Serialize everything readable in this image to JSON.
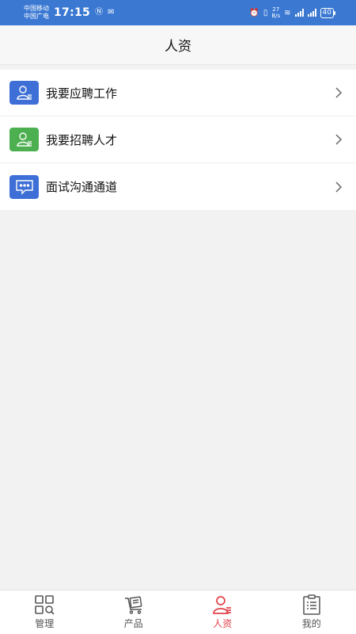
{
  "status_bar": {
    "carrier1": "中国移动",
    "carrier2": "中国广电",
    "time": "17:15",
    "net_speed_value": "27",
    "net_speed_unit": "B/s",
    "battery": "40"
  },
  "header": {
    "title": "人资"
  },
  "menu": {
    "items": [
      {
        "label": "我要应聘工作",
        "icon": "user-card-icon",
        "color": "#3d6fd6"
      },
      {
        "label": "我要招聘人才",
        "icon": "user-card-icon",
        "color": "#4caf50"
      },
      {
        "label": "面试沟通通道",
        "icon": "chat-bubble-icon",
        "color": "#3d6fd6"
      }
    ]
  },
  "bottom_nav": {
    "items": [
      {
        "label": "管理",
        "icon": "grid-search-icon",
        "active": false
      },
      {
        "label": "产品",
        "icon": "product-cart-icon",
        "active": false
      },
      {
        "label": "人资",
        "icon": "user-card-icon",
        "active": true
      },
      {
        "label": "我的",
        "icon": "clipboard-list-icon",
        "active": false
      }
    ],
    "active_color": "#e3404a"
  }
}
